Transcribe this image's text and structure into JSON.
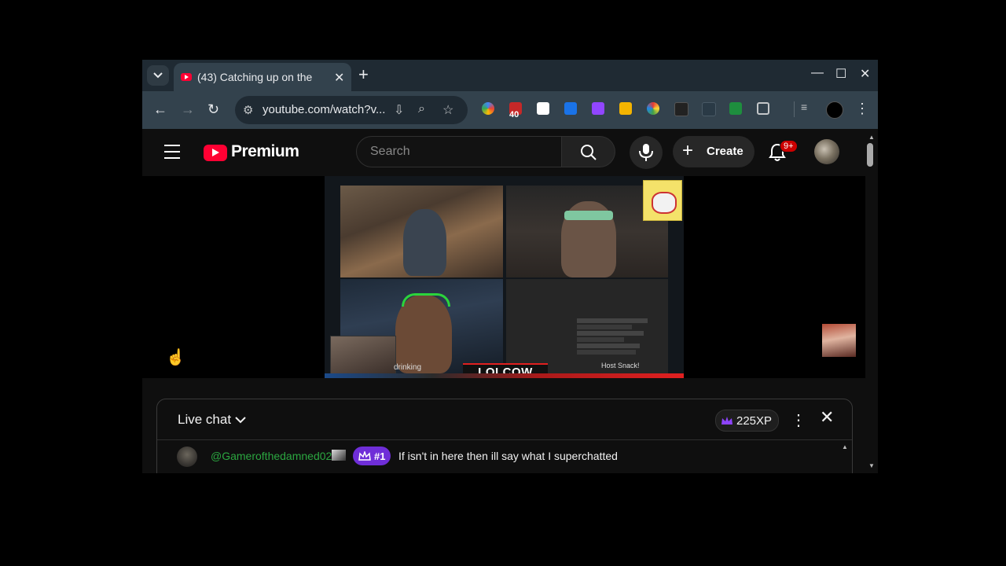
{
  "browser": {
    "tab_title": "(43) Catching up on the",
    "url": "youtube.com/watch?v...",
    "extension_badge": "40"
  },
  "youtube": {
    "brand": "Premium",
    "search_placeholder": "Search",
    "create_label": "Create",
    "notification_count": "9+"
  },
  "video": {
    "overlay_title": "LOLCOW LIVE",
    "overlay_caption": "drinking",
    "overlay_snack": "Host Snack!"
  },
  "chat": {
    "title": "Live chat",
    "xp": "225XP",
    "messages": [
      {
        "author": "@Gamerofthedamned02",
        "rank": "#1",
        "text": "If isn't in here then ill say what I superchatted"
      }
    ]
  },
  "colors": {
    "brand_red": "#ff0033",
    "author_green": "#2ba640",
    "rank_purple": "#6f2ed8"
  }
}
